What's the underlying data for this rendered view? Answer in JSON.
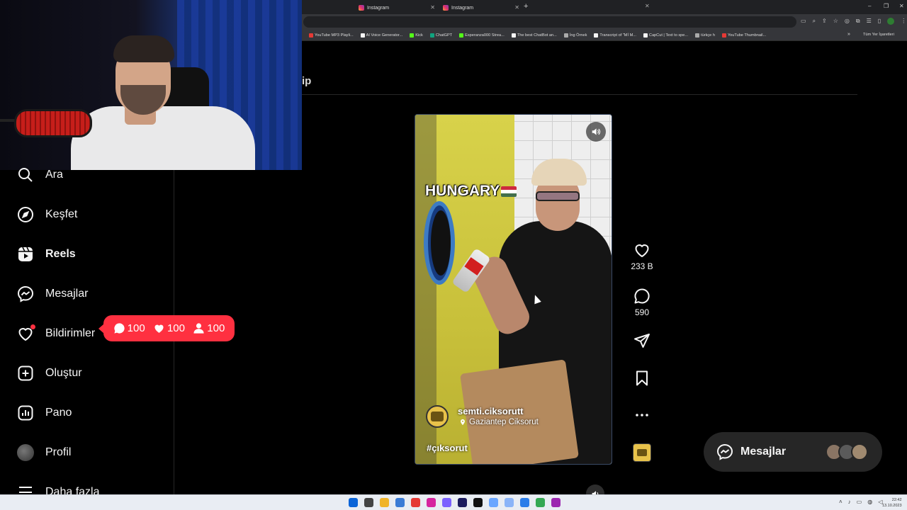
{
  "browser": {
    "tabs": [
      {
        "label": "Instagram"
      },
      {
        "label": "Instagram"
      }
    ],
    "new_tab": "+",
    "bookmarks": [
      {
        "label": "YouTube MP3 Playli...",
        "color": "#e53935"
      },
      {
        "label": "AI Voice Generator...",
        "color": "#f5f5f5"
      },
      {
        "label": "Kick",
        "color": "#53fc18"
      },
      {
        "label": "ChatGPT",
        "color": "#10a37f"
      },
      {
        "label": "Esperanza000 Strea...",
        "color": "#53fc18"
      },
      {
        "label": "The best ChatBot an...",
        "color": "#f5f5f5"
      },
      {
        "label": "İng Örnek",
        "color": "#aaaaaa"
      },
      {
        "label": "Transcript of \"Mİ M...",
        "color": "#f5f5f5"
      },
      {
        "label": "CapCut | Text to spe...",
        "color": "#f5f5f5"
      },
      {
        "label": "türkçe h",
        "color": "#aaaaaa"
      },
      {
        "label": "YouTube Thumbnail...",
        "color": "#e53935"
      }
    ],
    "bookmarks_more": "»",
    "all_bookmarks": "Tüm Yer İşaretleri",
    "profile_letter": "U"
  },
  "page": {
    "header_fragment": "ip"
  },
  "nav": {
    "items": [
      {
        "label": "Ara",
        "icon": "search-icon"
      },
      {
        "label": "Keşfet",
        "icon": "compass-icon"
      },
      {
        "label": "Reels",
        "icon": "reels-icon",
        "active": true
      },
      {
        "label": "Mesajlar",
        "icon": "messenger-icon"
      },
      {
        "label": "Bildirimler",
        "icon": "heart-icon"
      },
      {
        "label": "Oluştur",
        "icon": "plus-square-icon"
      },
      {
        "label": "Pano",
        "icon": "dashboard-icon"
      },
      {
        "label": "Profil",
        "icon": "avatar"
      },
      {
        "label": "Daha fazla",
        "icon": "menu-icon"
      }
    ]
  },
  "notification_popup": {
    "comments": "100",
    "likes": "100",
    "follows": "100",
    "color": "#ff3040"
  },
  "reel": {
    "overlay_text": "HUNGARY",
    "author": "semti.ciksorutt",
    "location": "Gaziantep Ciksorut",
    "hashtag": "#çıksorut",
    "likes": "233 B",
    "comments": "590"
  },
  "messages_pill": {
    "label": "Mesajlar"
  },
  "taskbar": {
    "time": "22:42",
    "date": "13.10.2023"
  }
}
